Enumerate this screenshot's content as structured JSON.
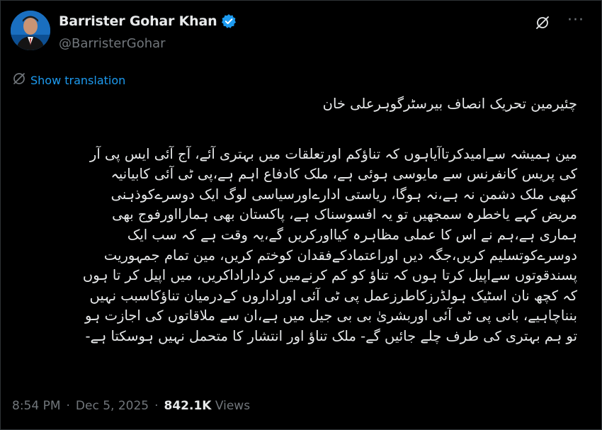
{
  "author": {
    "display_name": "Barrister Gohar Khan",
    "handle": "@BarristerGohar",
    "verified": true
  },
  "translate": {
    "label": "Show translation",
    "icon": "translate-icon"
  },
  "post": {
    "heading": "چئیرمین تحریک انصاف بیرسٹرگوہرعلی خان",
    "lines": [
      "مین ہمیشہ سےامیدکرتاآیاہوں کہ تناؤکم اورتعلقات میں بہتری آئے، آج آئی ایس پی آر",
      "کی پریس کانفرنس سے مایوسی ہوئی ہے، ملک کادفاع اہم ہے،پی ٹی آئی کابیانیہ",
      "کبھی ملک دشمن نہ ہے،نہ ہوگا، ریاستی ادارےاورسیاسی لوگ ایک دوسرےکوذہنی",
      "مریض کہے یاخطرہ سمجھیں تو یہ افسوسناک ہے، پاکستان بھی ہمارااورفوج بھی",
      "ہماری ہے،ہم نے اس کا عملی مظاہرہ کیااورکریں گے،یہ وقت ہے کہ سب ایک",
      "دوسرےکوتسلیم کریں،جگہ دیں اوراعتمادکےفقدان کوختم کریں، مین تمام جمہوریت",
      "پسندقوتوں سےاپیل کرتا ہوں کہ تناؤ کو کم کرنےمیں کرداراداکریں، میں اپیل کر تا ہوں",
      "کہ کچھ نان اسٹیک ہولڈرزکاطرزعمل پی ٹی آئی اوراداروں کےدرمیان تناؤکاسبب نہیں",
      "بنناچاہیے، بانی پی ٹی آئی اوربشریٰ بی بی جیل میں ہے،ان سے ملاقاتوں کی اجازت ہو",
      "تو ہم بہتری کی طرف چلے جائیں گے- ملک تناؤ اور انتشار کا متحمل نہیں ہوسکتا ہے-"
    ]
  },
  "meta": {
    "time": "8:54 PM",
    "separator": "·",
    "date": "Dec 5, 2025",
    "views_count": "842.1K",
    "views_label": "Views"
  },
  "colors": {
    "background": "#000000",
    "text": "#e7e9ea",
    "secondary": "#71767b",
    "link": "#1d9bf0",
    "verified_badge": "#1d9bf0"
  },
  "icons": [
    "verified-badge-icon",
    "grok-icon",
    "more-icon",
    "translate-icon"
  ]
}
